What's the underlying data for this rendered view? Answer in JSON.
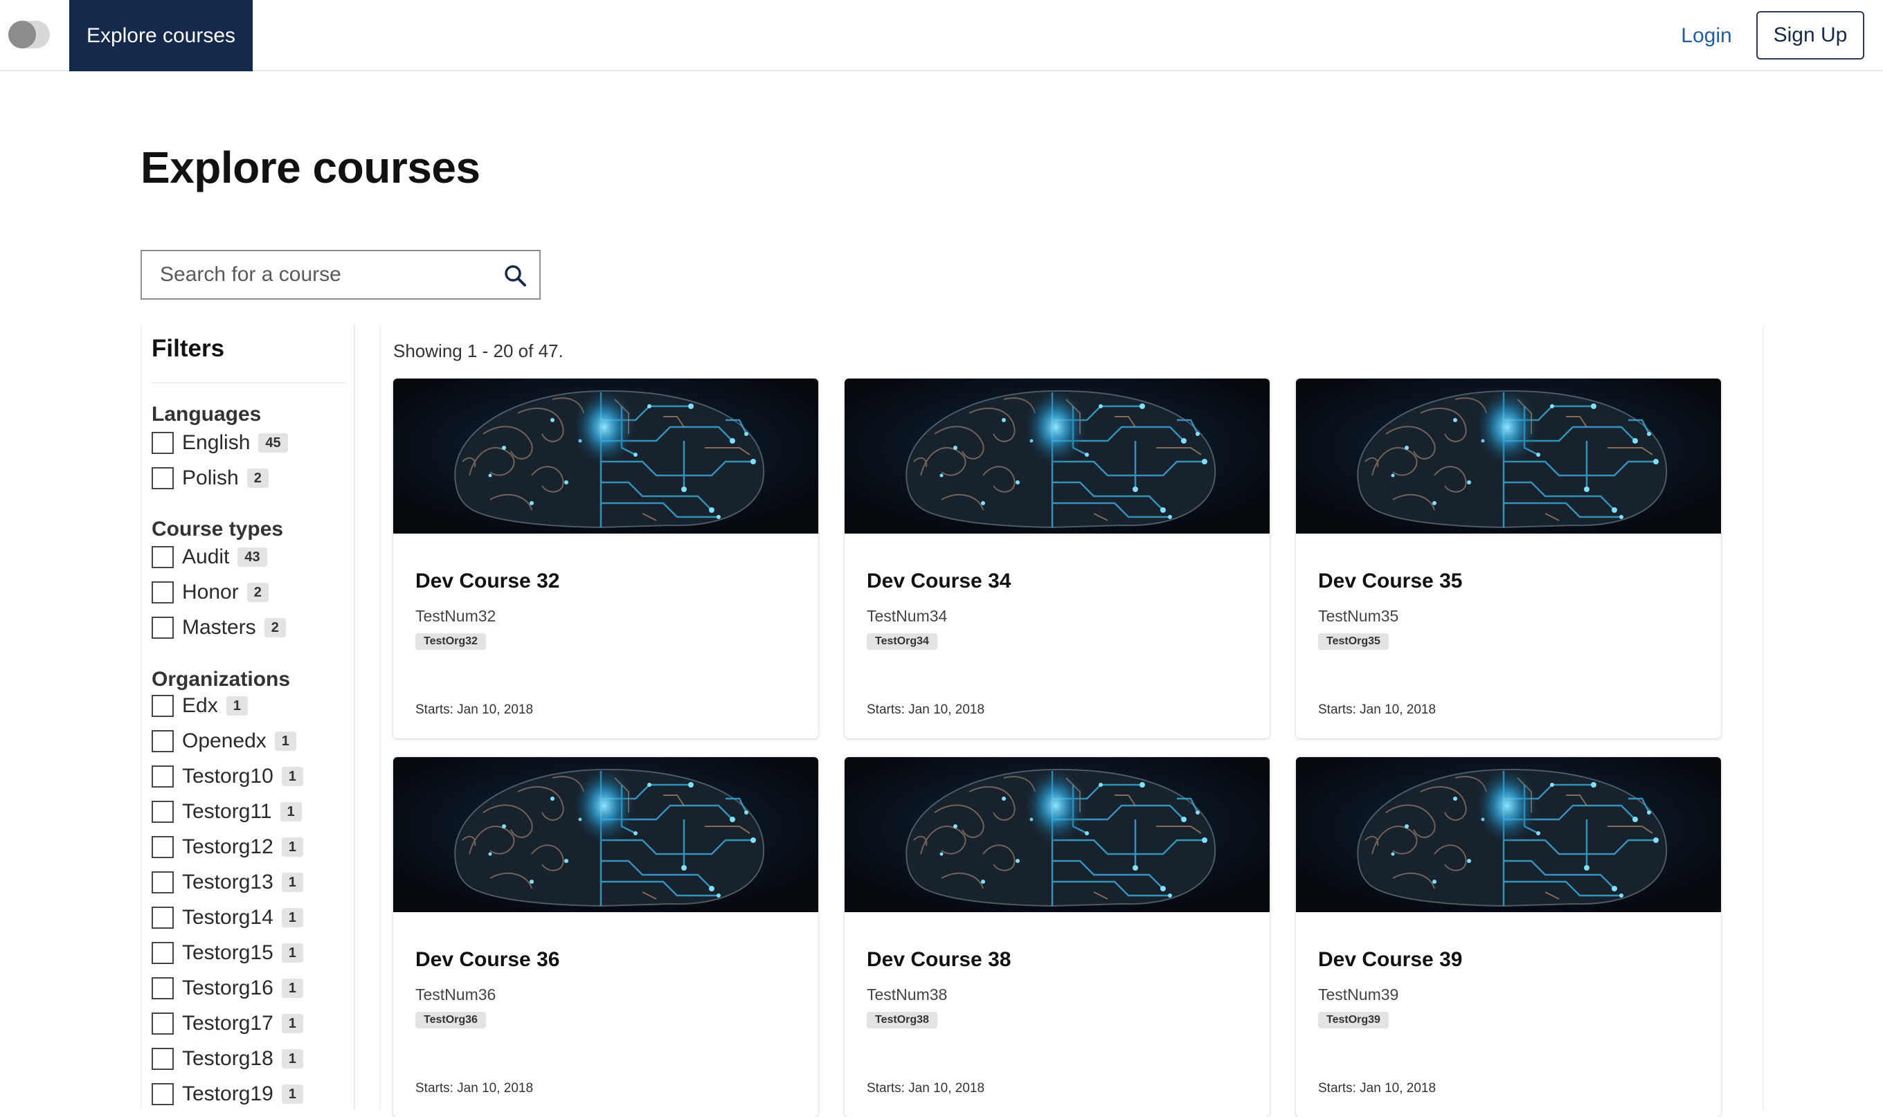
{
  "header": {
    "nav_explore": "Explore courses",
    "login": "Login",
    "signup": "Sign Up"
  },
  "page": {
    "title": "Explore courses"
  },
  "search": {
    "placeholder": "Search for a course"
  },
  "filters": {
    "title": "Filters",
    "groups": [
      {
        "title": "Languages",
        "items": [
          {
            "label": "English",
            "count": "45"
          },
          {
            "label": "Polish",
            "count": "2"
          }
        ]
      },
      {
        "title": "Course types",
        "items": [
          {
            "label": "Audit",
            "count": "43"
          },
          {
            "label": "Honor",
            "count": "2"
          },
          {
            "label": "Masters",
            "count": "2"
          }
        ]
      },
      {
        "title": "Organizations",
        "items": [
          {
            "label": "Edx",
            "count": "1"
          },
          {
            "label": "Openedx",
            "count": "1"
          },
          {
            "label": "Testorg10",
            "count": "1"
          },
          {
            "label": "Testorg11",
            "count": "1"
          },
          {
            "label": "Testorg12",
            "count": "1"
          },
          {
            "label": "Testorg13",
            "count": "1"
          },
          {
            "label": "Testorg14",
            "count": "1"
          },
          {
            "label": "Testorg15",
            "count": "1"
          },
          {
            "label": "Testorg16",
            "count": "1"
          },
          {
            "label": "Testorg17",
            "count": "1"
          },
          {
            "label": "Testorg18",
            "count": "1"
          },
          {
            "label": "Testorg19",
            "count": "1"
          }
        ]
      }
    ]
  },
  "results": {
    "showing": "Showing 1 - 20 of 47."
  },
  "courses": [
    {
      "title": "Dev Course 32",
      "number": "TestNum32",
      "org": "TestOrg32",
      "starts": "Starts: Jan 10, 2018"
    },
    {
      "title": "Dev Course 34",
      "number": "TestNum34",
      "org": "TestOrg34",
      "starts": "Starts: Jan 10, 2018"
    },
    {
      "title": "Dev Course 35",
      "number": "TestNum35",
      "org": "TestOrg35",
      "starts": "Starts: Jan 10, 2018"
    },
    {
      "title": "Dev Course 36",
      "number": "TestNum36",
      "org": "TestOrg36",
      "starts": "Starts: Jan 10, 2018"
    },
    {
      "title": "Dev Course 38",
      "number": "TestNum38",
      "org": "TestOrg38",
      "starts": "Starts: Jan 10, 2018"
    },
    {
      "title": "Dev Course 39",
      "number": "TestNum39",
      "org": "TestOrg39",
      "starts": "Starts: Jan 10, 2018"
    }
  ],
  "colors": {
    "nav_active_bg": "#15294c",
    "link": "#1f5fa6",
    "badge_bg": "#e3e3e3"
  },
  "icons": {
    "logo": "toggle-logo-icon",
    "search": "search-icon",
    "course_image": "circuit-brain-image"
  }
}
